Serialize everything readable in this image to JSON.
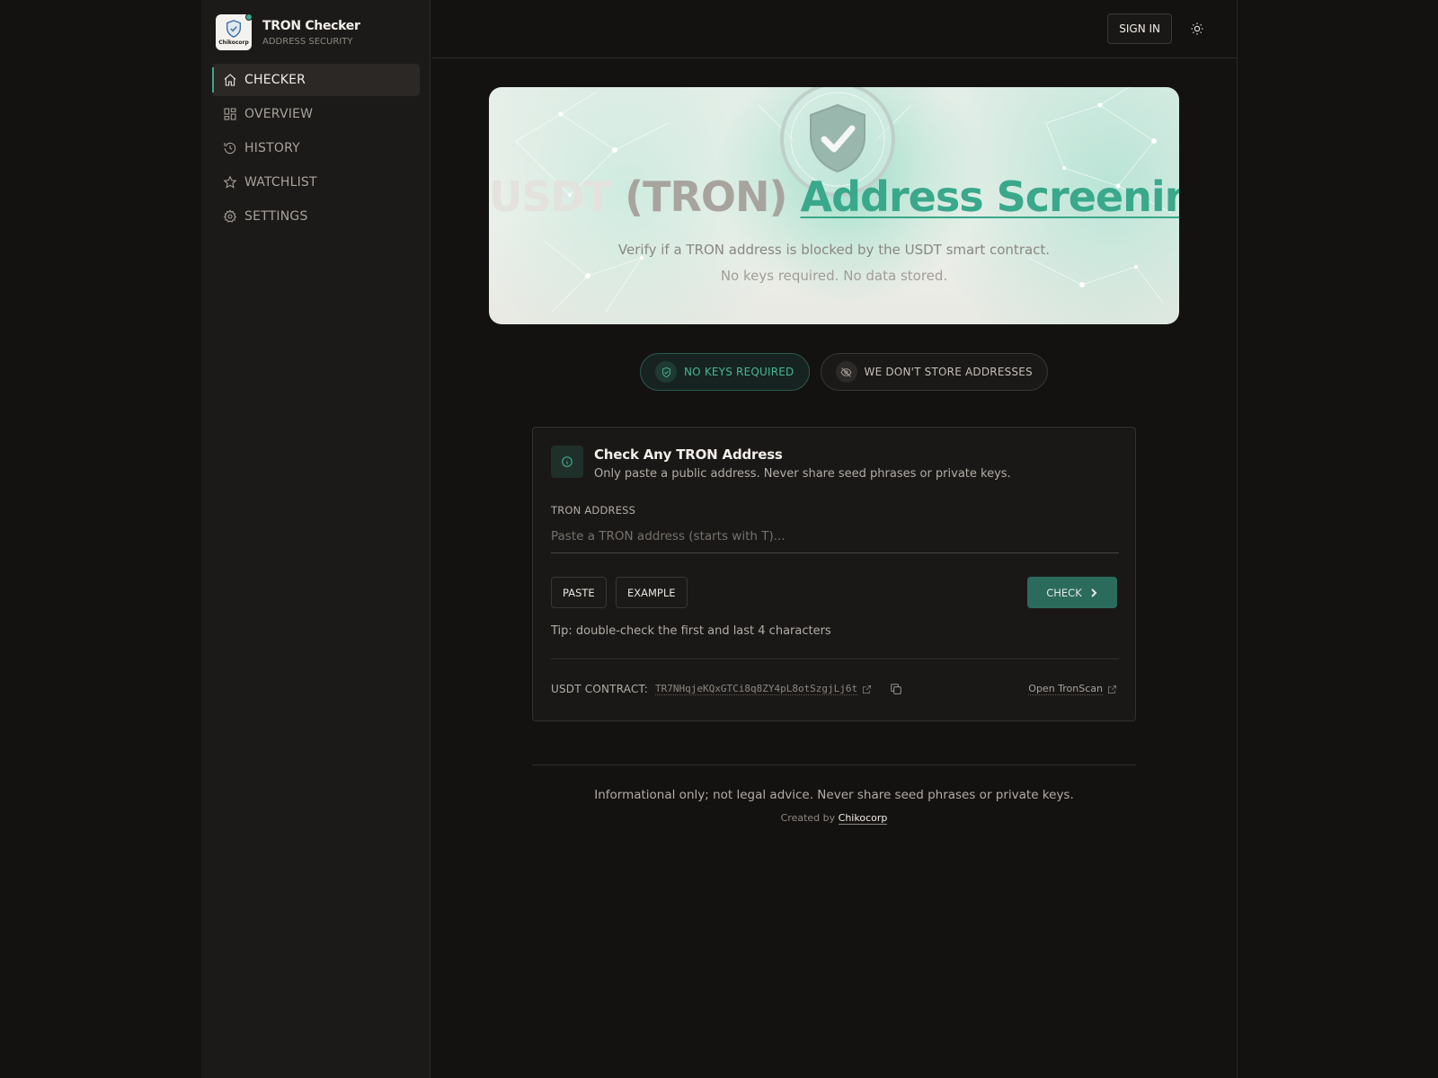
{
  "brand": {
    "title": "TRON Checker",
    "subtitle": "ADDRESS SECURITY",
    "logo_text": "Chikocorp"
  },
  "nav": {
    "items": [
      {
        "label": "CHECKER",
        "icon": "home-icon",
        "active": true
      },
      {
        "label": "OVERVIEW",
        "icon": "dashboard-icon",
        "active": false
      },
      {
        "label": "HISTORY",
        "icon": "history-icon",
        "active": false
      },
      {
        "label": "WATCHLIST",
        "icon": "star-icon",
        "active": false
      },
      {
        "label": "SETTINGS",
        "icon": "gear-icon",
        "active": false
      }
    ]
  },
  "topbar": {
    "signin_label": "SIGN IN",
    "theme_icon": "sun-icon"
  },
  "hero": {
    "title_part1": "USDT ",
    "title_part2": "(TRON) ",
    "title_part3": "Address Screening",
    "subtitle": "Verify if a TRON address is blocked by the USDT smart contract.",
    "subtitle2": "No keys required. No data stored."
  },
  "badges": [
    {
      "label": "NO KEYS REQUIRED",
      "icon": "shield-check-icon"
    },
    {
      "label": "WE DON'T STORE ADDRESSES",
      "icon": "eye-off-icon"
    }
  ],
  "card": {
    "title": "Check Any TRON Address",
    "subtitle": "Only paste a public address. Never share seed phrases or private keys.",
    "field_label": "TRON ADDRESS",
    "input_value": "",
    "input_placeholder": "Paste a TRON address (starts with T)...",
    "paste_label": "PASTE",
    "example_label": "EXAMPLE",
    "check_label": "CHECK",
    "tip": "Tip: double-check the first and last 4 characters",
    "contract_label": "USDT CONTRACT:",
    "contract_address": "TR7NHqjeKQxGTCi8q8ZY4pL8otSzgjLj6t",
    "tronscan_label": "Open TronScan"
  },
  "footer": {
    "disclaimer": "Informational only; not legal advice. Never share seed phrases or private keys.",
    "created_by": "Created by ",
    "creator": "Chikocorp"
  },
  "colors": {
    "accent": "#3aa88a",
    "background": "#141211",
    "sidebar": "#1c1a18"
  }
}
